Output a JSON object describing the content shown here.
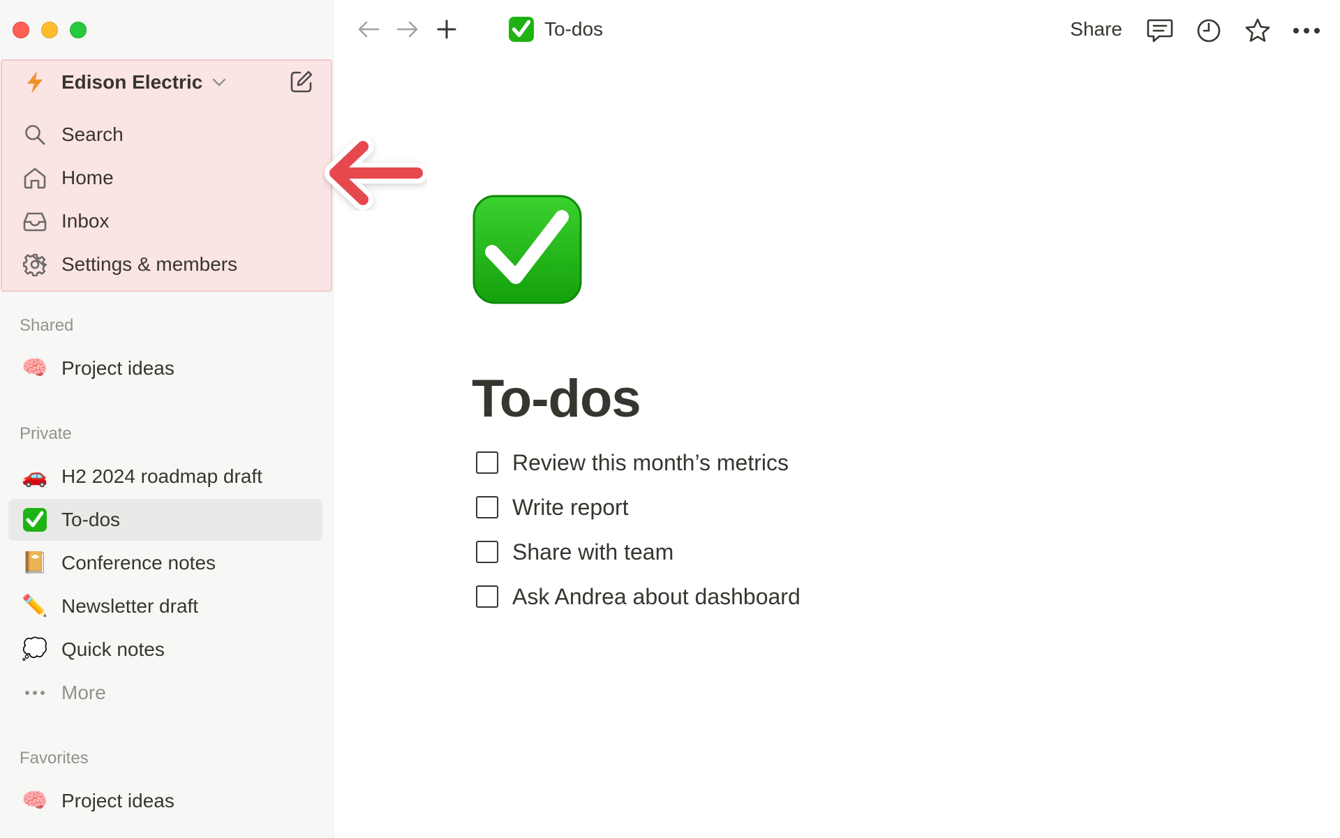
{
  "window": {
    "controls": [
      "close",
      "minimize",
      "maximize"
    ]
  },
  "sidebar": {
    "workspace": {
      "name": "Edison Electric",
      "icon": "lightning-icon"
    },
    "nav": [
      {
        "label": "Search",
        "icon": "search-icon"
      },
      {
        "label": "Home",
        "icon": "home-icon"
      },
      {
        "label": "Inbox",
        "icon": "inbox-icon"
      },
      {
        "label": "Settings & members",
        "icon": "gear-icon"
      }
    ],
    "shared": {
      "label": "Shared",
      "items": [
        {
          "label": "Project ideas",
          "emoji": "🧠"
        }
      ]
    },
    "private": {
      "label": "Private",
      "items": [
        {
          "label": "H2 2024 roadmap draft",
          "emoji": "🚗"
        },
        {
          "label": "To-dos",
          "emoji": "✅",
          "active": true
        },
        {
          "label": "Conference notes",
          "emoji": "📔"
        },
        {
          "label": "Newsletter draft",
          "emoji": "✏️"
        },
        {
          "label": "Quick notes",
          "emoji": "💭"
        }
      ],
      "more_label": "More"
    },
    "favorites": {
      "label": "Favorites",
      "items": [
        {
          "label": "Project ideas",
          "emoji": "🧠"
        }
      ]
    }
  },
  "topbar": {
    "page_title": "To-dos",
    "share_label": "Share",
    "icons": [
      "back-arrow-icon",
      "forward-arrow-icon",
      "plus-icon",
      "comment-icon",
      "clock-icon",
      "star-icon",
      "more-icon"
    ]
  },
  "page": {
    "title": "To-dos",
    "todos": [
      {
        "text": "Review this month’s metrics",
        "checked": false
      },
      {
        "text": "Write report",
        "checked": false
      },
      {
        "text": "Share with team",
        "checked": false
      },
      {
        "text": "Ask Andrea about dashboard",
        "checked": false
      }
    ]
  },
  "colors": {
    "sidebar_bg": "#f7f7f5",
    "highlight_bg": "#fbe4e4",
    "check_green": "#1db313",
    "arrow_red": "#e5484d",
    "text": "#37352f",
    "muted": "#91918e"
  }
}
